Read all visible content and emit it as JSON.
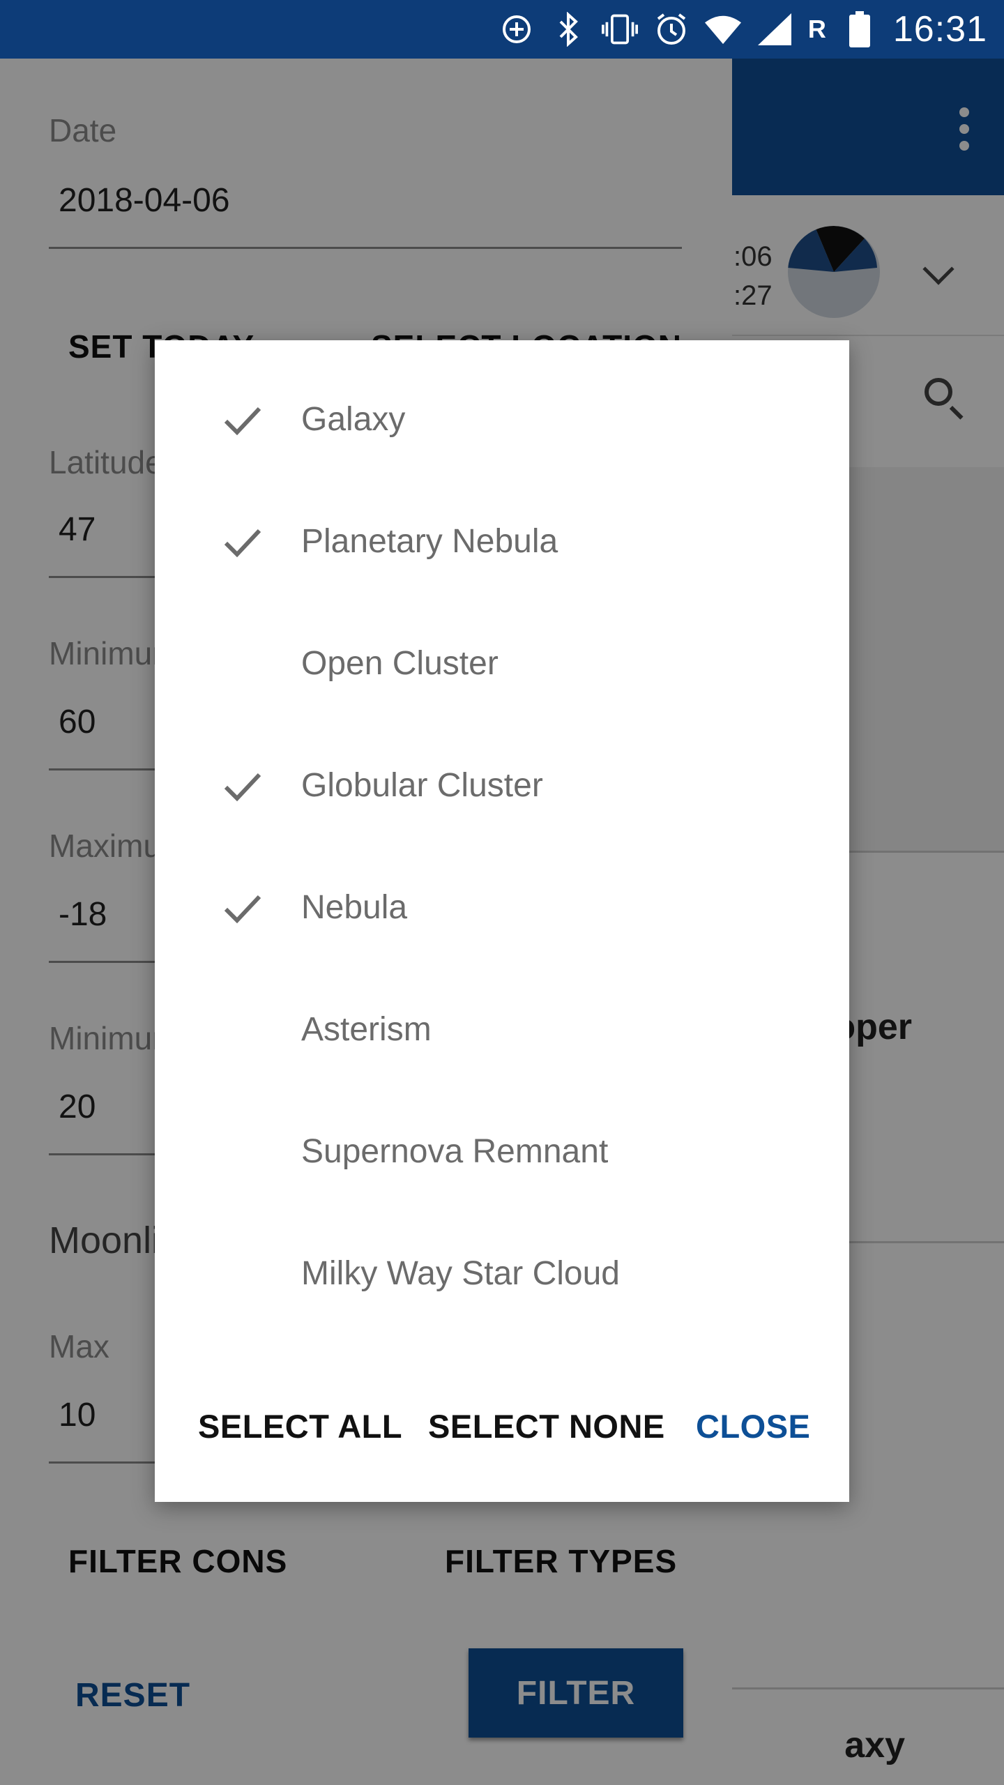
{
  "status_bar": {
    "time": "16:31",
    "network_letter": "R",
    "icons": [
      "data-saver-icon",
      "bluetooth-icon",
      "vibrate-icon",
      "alarm-icon",
      "wifi-icon",
      "signal-icon",
      "battery-icon"
    ]
  },
  "background": {
    "times_line1": ":06",
    "times_line2": ":27",
    "card1_title": "oper",
    "card2_title": "axy"
  },
  "drawer": {
    "date_label": "Date",
    "date_value": "2018-04-06",
    "set_today": "SET TODAY",
    "select_location": "SELECT LOCATION",
    "latitude_label": "Latitude",
    "latitude_value": "47",
    "minimum_label": "Minimum",
    "minimum_value": "60",
    "maximum_label": "Maximum",
    "maximum_value": "-18",
    "minimum2_label": "Minimum",
    "minimum2_value": "20",
    "moon_section": "Moonlight",
    "max_label": "Max",
    "max_value": "10",
    "filter_cons": "FILTER CONS",
    "filter_types": "FILTER TYPES",
    "reset": "RESET",
    "filter": "FILTER"
  },
  "dialog": {
    "items": [
      {
        "label": "Galaxy",
        "checked": true
      },
      {
        "label": "Planetary Nebula",
        "checked": true
      },
      {
        "label": "Open Cluster",
        "checked": false
      },
      {
        "label": "Globular Cluster",
        "checked": true
      },
      {
        "label": "Nebula",
        "checked": true
      },
      {
        "label": "Asterism",
        "checked": false
      },
      {
        "label": "Supernova Remnant",
        "checked": false
      },
      {
        "label": "Milky Way Star Cloud",
        "checked": false
      }
    ],
    "select_all": "SELECT ALL",
    "select_none": "SELECT NONE",
    "close": "CLOSE"
  },
  "colors": {
    "primary": "#0d4f96",
    "status_bar": "#0d3c78"
  }
}
